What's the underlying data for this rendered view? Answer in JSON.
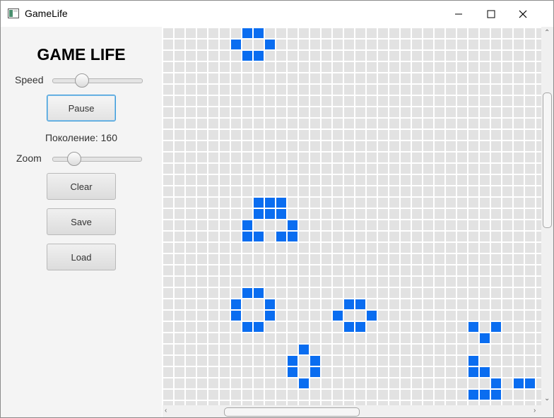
{
  "window": {
    "title": "GameLife"
  },
  "sidebar": {
    "title": "GAME LIFE",
    "speed_label": "Speed",
    "speed_value": 0.3,
    "pause_label": "Pause",
    "generation_text": "Поколение: 160",
    "zoom_label": "Zoom",
    "zoom_value": 0.2,
    "clear_label": "Clear",
    "save_label": "Save",
    "load_label": "Load"
  },
  "board": {
    "alive_color": "#0a6df0",
    "dead_color": "#e2e2e2",
    "gridline_color": "#ffffff",
    "live_cells": [
      [
        7,
        0
      ],
      [
        8,
        0
      ],
      [
        6,
        1
      ],
      [
        9,
        1
      ],
      [
        7,
        2
      ],
      [
        8,
        2
      ],
      [
        8,
        15
      ],
      [
        9,
        15
      ],
      [
        10,
        15
      ],
      [
        8,
        16
      ],
      [
        9,
        16
      ],
      [
        10,
        16
      ],
      [
        7,
        17
      ],
      [
        11,
        17
      ],
      [
        7,
        18
      ],
      [
        8,
        18
      ],
      [
        10,
        18
      ],
      [
        11,
        18
      ],
      [
        7,
        23
      ],
      [
        8,
        23
      ],
      [
        6,
        24
      ],
      [
        9,
        24
      ],
      [
        6,
        25
      ],
      [
        9,
        25
      ],
      [
        7,
        26
      ],
      [
        8,
        26
      ],
      [
        16,
        24
      ],
      [
        17,
        24
      ],
      [
        15,
        25
      ],
      [
        18,
        25
      ],
      [
        16,
        26
      ],
      [
        17,
        26
      ],
      [
        12,
        28
      ],
      [
        11,
        29
      ],
      [
        13,
        29
      ],
      [
        11,
        30
      ],
      [
        13,
        30
      ],
      [
        12,
        31
      ],
      [
        27,
        26
      ],
      [
        29,
        26
      ],
      [
        28,
        27
      ],
      [
        27,
        29
      ],
      [
        27,
        30
      ],
      [
        28,
        30
      ],
      [
        29,
        31
      ],
      [
        31,
        31
      ],
      [
        32,
        31
      ],
      [
        27,
        32
      ],
      [
        28,
        32
      ],
      [
        29,
        32
      ]
    ]
  }
}
